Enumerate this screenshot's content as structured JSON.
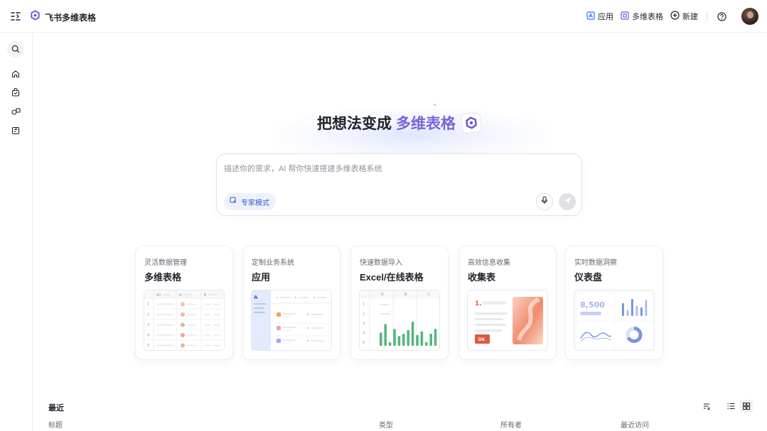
{
  "header": {
    "brand_title": "飞书多维表格",
    "actions": [
      {
        "label": "应用",
        "icon": "app-icon"
      },
      {
        "label": "多维表格",
        "icon": "base-icon"
      },
      {
        "label": "新建",
        "icon": "plus-circle-icon"
      }
    ],
    "help_icon": "help-icon"
  },
  "sidebar": {
    "items": [
      "search-icon",
      "home-icon",
      "bag-icon",
      "shapes-icon",
      "template-icon"
    ]
  },
  "hero": {
    "title_prefix": "把想法变成",
    "title_accent": "多维表格",
    "accent_color": "#7b64d9"
  },
  "prompt": {
    "placeholder": "描述你的需求，AI 帮你快速搭建多维表格系统",
    "expert_mode_label": "专家模式"
  },
  "cards": [
    {
      "subtitle": "灵活数据管理",
      "title": "多维表格",
      "preview": {
        "headers": [
          "A1",
          "A",
          "B"
        ],
        "rows": [
          "1",
          "2",
          "3",
          "4",
          "5"
        ]
      }
    },
    {
      "subtitle": "定制业务系统",
      "title": "应用",
      "preview": {
        "logo": "A"
      }
    },
    {
      "subtitle": "快速数据导入",
      "title": "Excel/在线表格",
      "preview": {
        "headers": [
          "A",
          "B",
          "C"
        ],
        "rows": [
          "1",
          "2",
          "3",
          "4",
          "5"
        ],
        "bars": [
          0.55,
          0.9,
          0.15,
          0.7,
          0.4,
          0.5,
          0.65,
          1.0,
          0.45,
          0.6,
          0.15,
          0.5,
          0.7
        ]
      }
    },
    {
      "subtitle": "高效信息收集",
      "title": "收集表",
      "preview": {
        "step": "1.",
        "ok_label": "OK"
      }
    },
    {
      "subtitle": "实时数据洞察",
      "title": "仪表盘",
      "preview": {
        "metric": "8,500",
        "bars": [
          0.75,
          0.35,
          1.0,
          0.6,
          0.5,
          0.95
        ]
      }
    }
  ],
  "recent": {
    "title": "最近",
    "columns": {
      "title": "标题",
      "type": "类型",
      "owner": "所有者",
      "last_visit": "最近访问"
    }
  }
}
